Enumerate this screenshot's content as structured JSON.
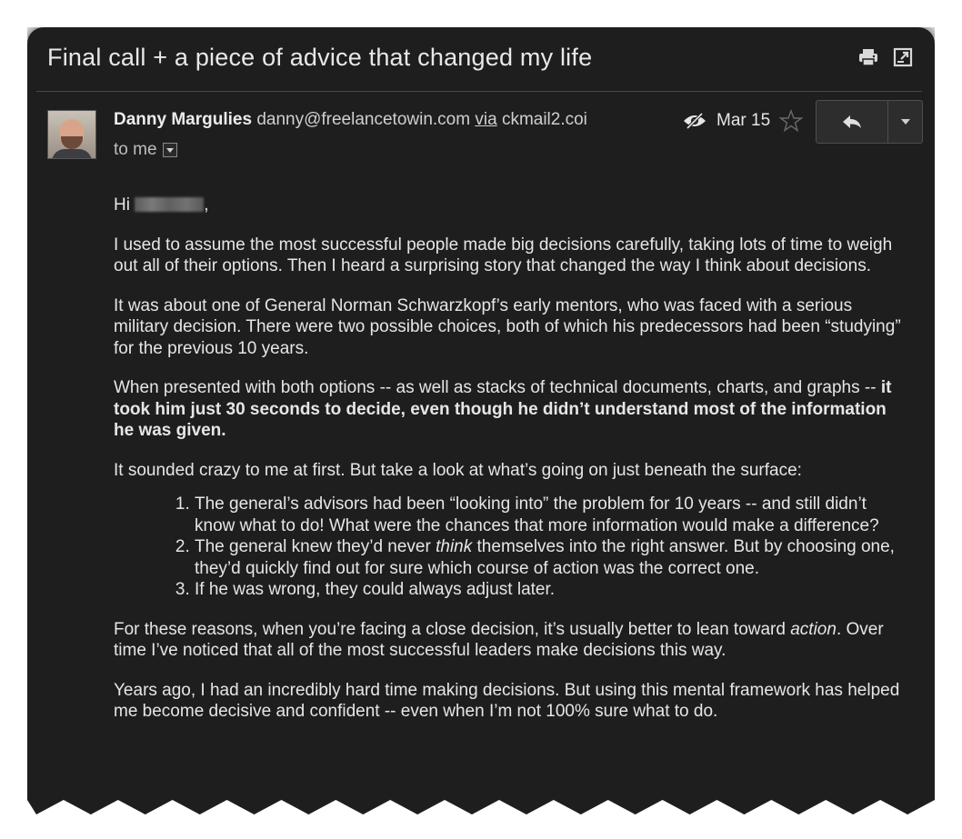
{
  "email": {
    "subject": "Final call + a piece of advice that changed my life",
    "sender_name": "Danny Margulies",
    "sender_email": "danny@freelancetowin.com",
    "via_label": "via",
    "via_domain": "ckmail2.coi",
    "to_label": "to me",
    "date": "Mar 15",
    "greeting_prefix": "Hi",
    "greeting_suffix": ",",
    "p1": "I used to assume the most successful people made big decisions carefully, taking lots of time to weigh out all of their options. Then I heard a surprising story that changed the way I think about decisions.",
    "p2": "It was about one of General Norman Schwarzkopf’s early mentors, who was faced with a serious military decision. There were two possible choices, both of which his predecessors had been “studying” for the previous 10 years.",
    "p3_start": "When presented with both options -- as well as stacks of technical documents, charts, and graphs --",
    "p3_bold": "it took him just 30 seconds to decide, even though he didn’t understand most of the information he was given.",
    "p4": "It sounded crazy to me at first. But take a look at what’s going on just beneath the surface:",
    "list": {
      "item1": "The general’s advisors had been “looking into” the problem for 10 years -- and still didn’t know what to do! What were the chances that more information would make a difference?",
      "item2_start": "The general knew they’d never",
      "item2_em": "think",
      "item2_end": "themselves into the right answer. But by choosing one, they’d quickly find out for sure which course of action was the correct one.",
      "item3": "If he was wrong, they could always adjust later."
    },
    "p5_start": "For these reasons, when you’re facing a close decision, it’s usually better to lean toward",
    "p5_em": "action",
    "p5_end": ". Over time I’ve noticed that all of the most successful leaders make decisions this way.",
    "p6": "Years ago, I had an incredibly hard time making decisions. But using this mental framework has helped me become decisive and confident -- even when I’m not 100% sure what to do."
  },
  "icons": {
    "print": "printer-icon",
    "popout": "open-in-new-window-icon",
    "eye": "eye-slash-icon",
    "star": "star-icon",
    "reply": "reply-icon",
    "more": "chevron-down-icon"
  },
  "colors": {
    "background": "#1e1e1e",
    "text": "#e6e6e6"
  }
}
